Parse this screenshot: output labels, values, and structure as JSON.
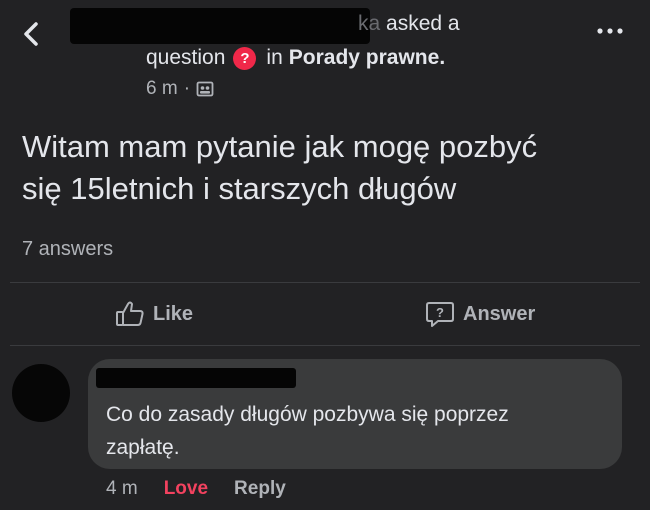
{
  "post": {
    "author_suffix": "ka",
    "asked_text": "asked a",
    "question_word": "question",
    "question_badge": "?",
    "in_word": "in",
    "group_name": "Porady prawne.",
    "time": "6 m",
    "meta_separator": "·",
    "body_line1": "Witam mam pytanie jak mogę pozbyć",
    "body_line2": "się 15letnich i starszych długów",
    "answers_count": "7 answers"
  },
  "actions": {
    "like_label": "Like",
    "answer_label": "Answer"
  },
  "comment": {
    "text_line1": "Co do zasady długów pozbywa się poprzez",
    "text_line2": "zapłatę.",
    "time": "4 m",
    "love_label": "Love",
    "reply_label": "Reply"
  },
  "icons": {
    "back": "chevron-left-icon",
    "more": "more-dots-icon",
    "group": "group-icon",
    "like": "thumbs-up-icon",
    "answer": "question-bubble-icon"
  },
  "colors": {
    "background": "#222224",
    "bubble": "#3a3b3c",
    "love": "#f3425f",
    "badge": "#f02849"
  }
}
